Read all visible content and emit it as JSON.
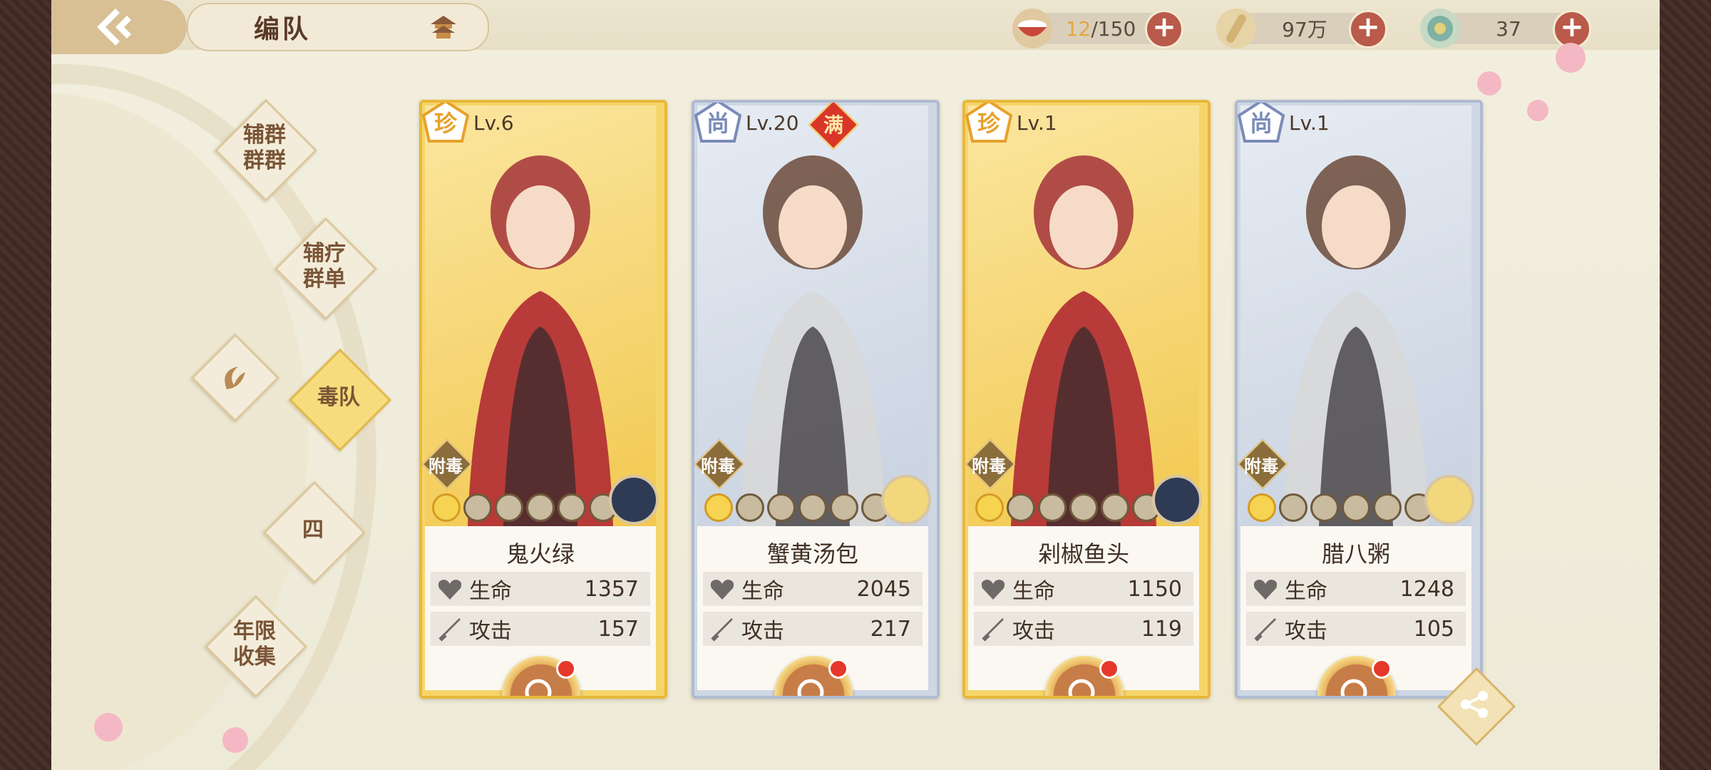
{
  "header": {
    "title": "编队",
    "resources": [
      {
        "id": "stamina",
        "current": "12",
        "max": "/150",
        "icon": "bowl-icon"
      },
      {
        "id": "coins",
        "value": "97万",
        "icon": "coin-icon"
      },
      {
        "id": "gems",
        "value": "37",
        "icon": "gem-icon"
      }
    ]
  },
  "side_menu": [
    {
      "label": "辅群\n群群",
      "active": false
    },
    {
      "label": "辅疗\n群单",
      "active": false
    },
    {
      "label": "毒队",
      "active": true
    },
    {
      "label": "四",
      "active": false
    },
    {
      "label": "年限\n收集",
      "active": false
    }
  ],
  "cards": [
    {
      "rank": "珍",
      "rank_color": "#e8a02a",
      "level": "Lv.6",
      "full": false,
      "tag": "附毒",
      "name": "鬼火绿",
      "hp_label": "生命",
      "hp": "1357",
      "atk_label": "攻击",
      "atk": "157",
      "stars_on": 1,
      "stars_total": 6,
      "frame": "gold"
    },
    {
      "rank": "尚",
      "rank_color": "#7a8bb8",
      "level": "Lv.20",
      "full": true,
      "full_label": "满",
      "tag": "附毒",
      "name": "蟹黄汤包",
      "hp_label": "生命",
      "hp": "2045",
      "atk_label": "攻击",
      "atk": "217",
      "stars_on": 1,
      "stars_total": 6,
      "frame": "silver"
    },
    {
      "rank": "珍",
      "rank_color": "#e8a02a",
      "level": "Lv.1",
      "full": false,
      "tag": "附毒",
      "name": "剁椒鱼头",
      "hp_label": "生命",
      "hp": "1150",
      "atk_label": "攻击",
      "atk": "119",
      "stars_on": 1,
      "stars_total": 6,
      "frame": "gold"
    },
    {
      "rank": "尚",
      "rank_color": "#7a8bb8",
      "level": "Lv.1",
      "full": false,
      "tag": "附毒",
      "name": "腊八粥",
      "hp_label": "生命",
      "hp": "1248",
      "atk_label": "攻击",
      "atk": "105",
      "stars_on": 1,
      "stars_total": 6,
      "frame": "silver"
    }
  ],
  "colors": {
    "accent": "#c77d47",
    "gold_frame": "#e9b83a",
    "silver_frame": "#aebbd0",
    "plus_button": "#b95a4a"
  }
}
